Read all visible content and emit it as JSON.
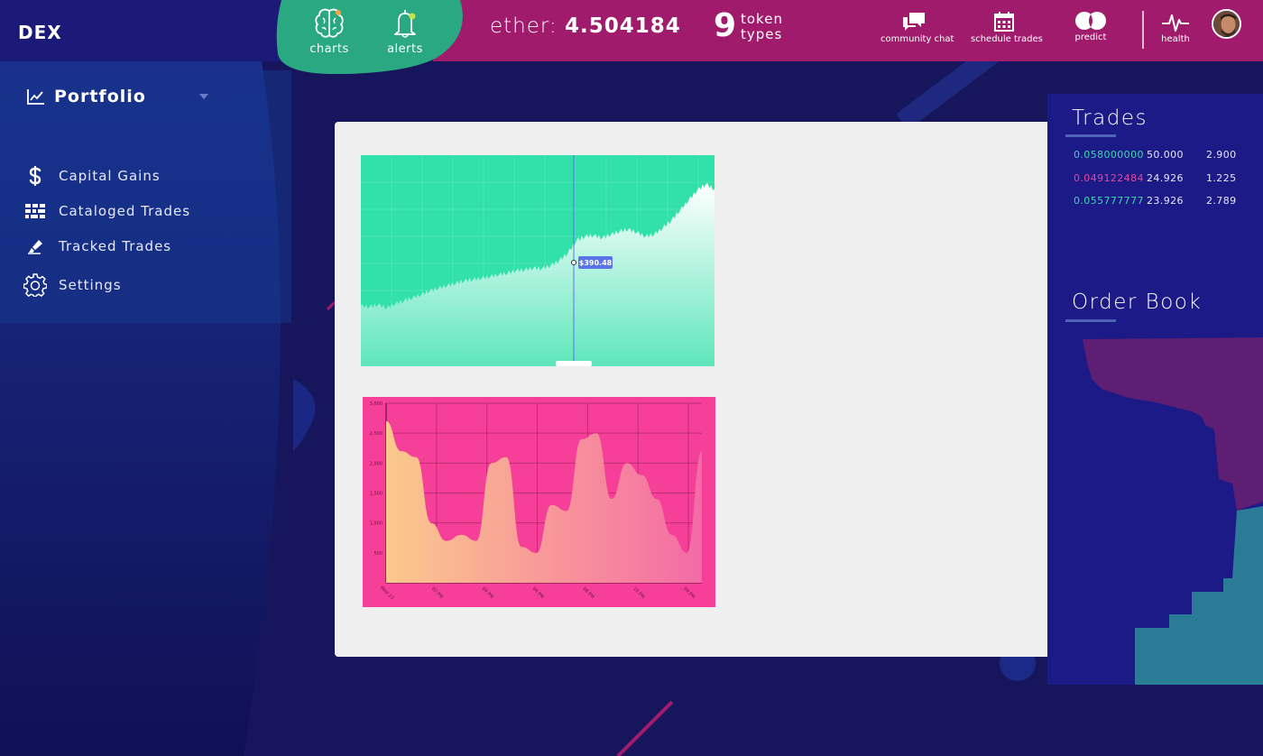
{
  "app": {
    "logo": "DEX"
  },
  "topnav": {
    "charts_label": "charts",
    "alerts_label": "alerts",
    "ether_label": "ether:",
    "ether_value": "4.504184",
    "token_count": "9",
    "token_label_1": "token",
    "token_label_2": "types",
    "community_chat": "community chat",
    "schedule_trades": "schedule trades",
    "predict": "predict",
    "health": "health"
  },
  "sidebar": {
    "title": "Portfolio",
    "items": [
      {
        "label": "Capital Gains",
        "icon": "dollar-icon"
      },
      {
        "label": "Cataloged Trades",
        "icon": "grid-icon"
      },
      {
        "label": "Tracked Trades",
        "icon": "highlighter-icon"
      },
      {
        "label": "Settings",
        "icon": "gear-icon"
      }
    ]
  },
  "charts": {
    "price_tooltip": "$390.48"
  },
  "trades": {
    "title": "Trades",
    "rows": [
      {
        "price": "0.058000000",
        "amount": "50.000",
        "total": "2.900",
        "color": "#3fd6b0"
      },
      {
        "price": "0.049122484",
        "amount": "24.926",
        "total": "1.225",
        "color": "#e5489e"
      },
      {
        "price": "0.055777777",
        "amount": "23.926",
        "total": "2.789",
        "color": "#3fd6b0"
      }
    ]
  },
  "order_book": {
    "title": "Order Book"
  },
  "colors": {
    "topbar_left": "#1b1a78",
    "topbar_right": "#a11b6c",
    "teal": "#2aa882",
    "chart_green": "#32e0a9",
    "chart_pink": "#f53f98",
    "panel": "#efefef"
  },
  "chart_data": [
    {
      "type": "area",
      "title": "",
      "series": [
        {
          "values": [
            120,
            118,
            122,
            116,
            124,
            130,
            136,
            142,
            150,
            155,
            160,
            165,
            170,
            172,
            175,
            178,
            182,
            185,
            190,
            192,
            195,
            194,
            200,
            210,
            225,
            250,
            258,
            260,
            255,
            262,
            268,
            272,
            266,
            258,
            262,
            275,
            290,
            310,
            330,
            350,
            362,
            352
          ]
        }
      ],
      "tooltip": "$390.48"
    },
    {
      "type": "area",
      "title": "",
      "x": [
        "Wed 23",
        "02 PM",
        "04 PM",
        "06 PM",
        "08 PM",
        "10 PM",
        "09 PM"
      ],
      "series": [
        {
          "values": [
            2700,
            2200,
            2100,
            1000,
            700,
            800,
            700,
            2000,
            2100,
            600,
            500,
            1300,
            1200,
            2400,
            2500,
            1400,
            2000,
            1800,
            1400,
            800,
            500,
            2200
          ]
        }
      ],
      "ylim": [
        0,
        3000
      ],
      "yticks": [
        "500",
        "1,000",
        "1,500",
        "2,000",
        "2,500",
        "3,000"
      ]
    }
  ]
}
